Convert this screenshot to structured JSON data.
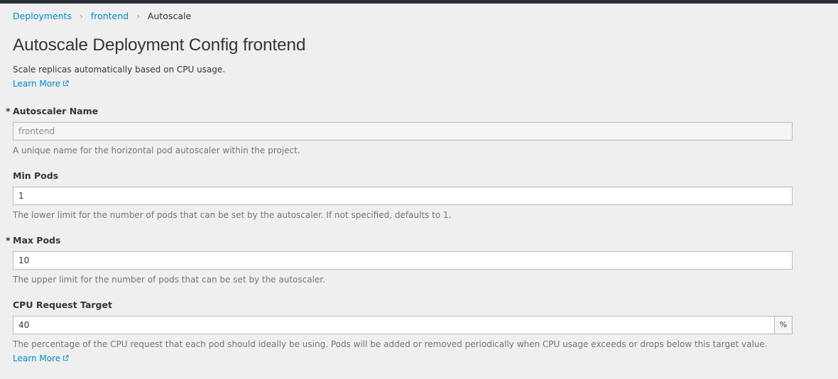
{
  "breadcrumb": {
    "items": [
      "Deployments",
      "frontend"
    ],
    "current": "Autoscale",
    "separator": "›"
  },
  "page": {
    "title": "Autoscale Deployment Config frontend",
    "description": "Scale replicas automatically based on CPU usage.",
    "learn_more": "Learn More"
  },
  "form": {
    "autoscaler_name": {
      "label": "Autoscaler Name",
      "required_mark": "*",
      "value": "frontend",
      "help": "A unique name for the horizontal pod autoscaler within the project."
    },
    "min_pods": {
      "label": "Min Pods",
      "value": "1",
      "help": "The lower limit for the number of pods that can be set by the autoscaler. If not specified, defaults to 1."
    },
    "max_pods": {
      "label": "Max Pods",
      "required_mark": "*",
      "value": "10",
      "help": "The upper limit for the number of pods that can be set by the autoscaler."
    },
    "cpu_target": {
      "label": "CPU Request Target",
      "value": "40",
      "unit": "%",
      "help": "The percentage of the CPU request that each pod should ideally be using. Pods will be added or removed periodically when CPU usage exceeds or drops below this target value.",
      "learn_more": "Learn More"
    }
  },
  "colors": {
    "link": "#0088ce",
    "topbar": "#292e34",
    "background": "#efefef"
  },
  "icons": [
    "external-link-icon",
    "breadcrumb-separator-icon"
  ]
}
